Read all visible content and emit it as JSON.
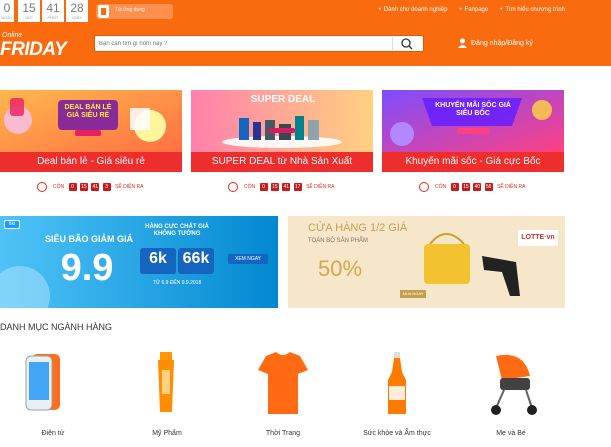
{
  "topbar": {
    "countdown": [
      {
        "value": "0",
        "label": "NGÀY"
      },
      {
        "value": "15",
        "label": "GIỜ"
      },
      {
        "value": "41",
        "label": "PHÚT"
      },
      {
        "value": "28",
        "label": "GIÂY"
      }
    ],
    "app_label": "Tải ứng dụng",
    "links": [
      "Dành cho doanh nghiệp",
      "Fanpage",
      "Tìm hiểu chương trình"
    ]
  },
  "header": {
    "logo_online": "Online",
    "logo_friday": "FRIDAY",
    "search_placeholder": "Bạn cần tìm gì hôm nay ?",
    "login_label": "Đăng nhập/Đăng ký"
  },
  "deals": [
    {
      "art_text": "DEAL BÁN LẺ GIÁ SIÊU RẺ",
      "title": "Deal bán lẻ - Giá siêu rẻ",
      "prefix": "CÒN",
      "boxes": [
        "0",
        "15",
        "41",
        "3"
      ],
      "suffix": "SẼ DIỄN RA"
    },
    {
      "art_text": "SUPER DEAL",
      "title": "SUPER DEAL từ Nhà Sản Xuất",
      "prefix": "CÒN",
      "boxes": [
        "0",
        "15",
        "41",
        "17"
      ],
      "suffix": "SẼ DIỄN RA"
    },
    {
      "art_text": "KHUYẾN MÃI SỐC GIÁ SIÊU BỐC",
      "title": "Khuyến mãi sốc - Giá cực Bốc",
      "prefix": "CÒN",
      "boxes": [
        "0",
        "15",
        "40",
        "56"
      ],
      "suffix": "SẼ DIỄN RA"
    }
  ],
  "banners": {
    "left": {
      "badge": "tiki",
      "headline": "SIÊU BÃO GIẢM GIÁ",
      "big": "9.9",
      "note": "HÀNG CỰC CHẤT GIÁ KHÔNG TƯỞNG",
      "price1": "6k",
      "price2": "66k",
      "cta": "XEM NGAY",
      "dates": "TỪ 6.9 ĐẾN 9.9.2018"
    },
    "right": {
      "headline": "CỬA HÀNG 1/2 GIÁ",
      "sub": "TOÀN BỘ SẢN PHẨM",
      "discount": "50%",
      "cta": "MUA NGAY",
      "brand": "LOTTE·vn"
    }
  },
  "categories": {
    "title": "DANH MỤC NGÀNH HÀNG",
    "items": [
      {
        "label": "Điện tử"
      },
      {
        "label": "Mỹ Phẩm"
      },
      {
        "label": "Thời Trang"
      },
      {
        "label": "Sức khỏe và Ẩm thực"
      },
      {
        "label": "Mẹ và Bé"
      }
    ]
  },
  "colors": {
    "brand": "#fa6b10",
    "deal_red": "#ee2d2d"
  }
}
